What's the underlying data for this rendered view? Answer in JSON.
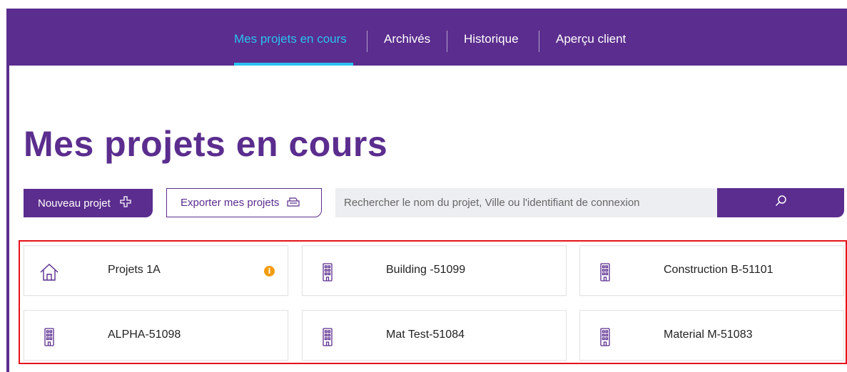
{
  "nav": {
    "items": [
      {
        "label": "Mes projets en cours",
        "active": true
      },
      {
        "label": "Archivés",
        "active": false
      },
      {
        "label": "Historique",
        "active": false
      },
      {
        "label": "Aperçu client",
        "active": false
      }
    ]
  },
  "page": {
    "title": "Mes projets en cours"
  },
  "toolbar": {
    "new_project_label": "Nouveau projet",
    "new_project_icon": "plus-icon",
    "export_label": "Exporter mes projets",
    "export_icon": "printer-icon"
  },
  "search": {
    "placeholder": "Rechercher le nom du projet, Ville ou l'identifiant de connexion",
    "value": "",
    "icon": "search-icon"
  },
  "projects": [
    {
      "name": "Projets 1A",
      "icon": "house-icon",
      "info": true
    },
    {
      "name": "Building -51099",
      "icon": "building-icon",
      "info": false
    },
    {
      "name": "Construction B-51101",
      "icon": "building-icon",
      "info": false
    },
    {
      "name": "ALPHA-51098",
      "icon": "building-icon",
      "info": false
    },
    {
      "name": "Mat Test-51084",
      "icon": "building-icon",
      "info": false
    },
    {
      "name": "Material M-51083",
      "icon": "building-icon",
      "info": false
    }
  ],
  "colors": {
    "brand_purple": "#5b2d8e",
    "active_nav": "#29c2f0",
    "info_badge": "#f39c11",
    "highlight_border": "#e4131a"
  }
}
